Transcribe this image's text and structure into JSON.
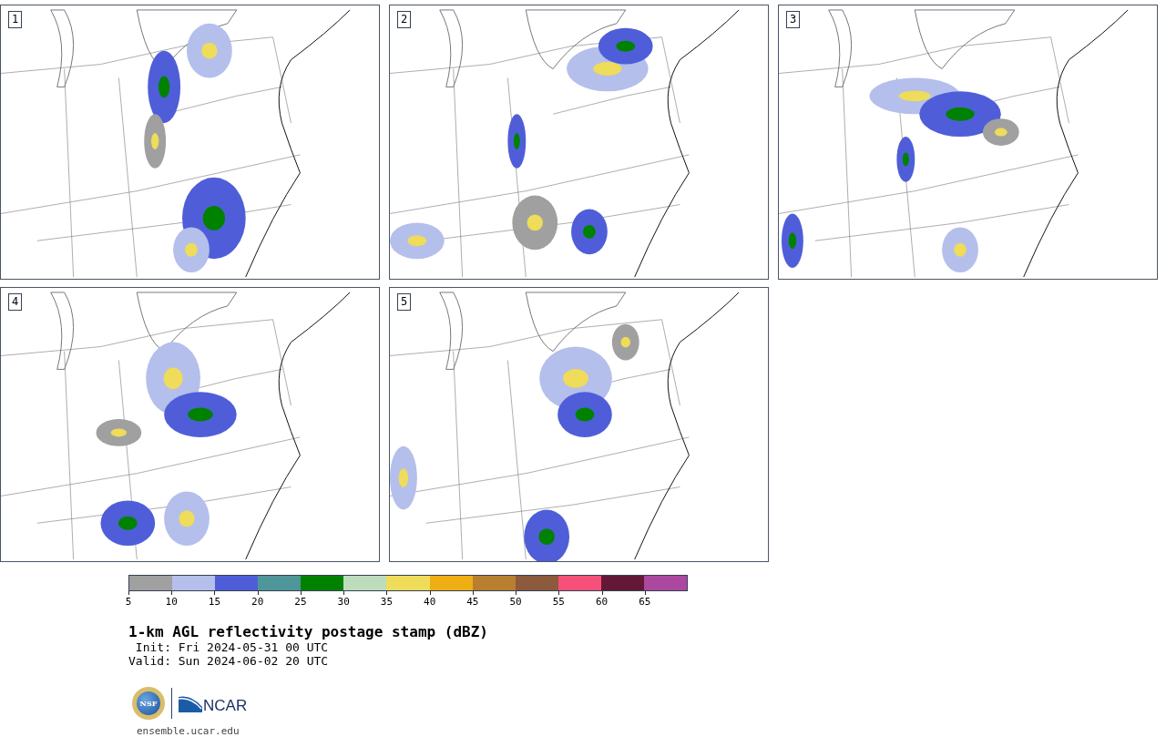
{
  "panels": [
    {
      "label": "1"
    },
    {
      "label": "2"
    },
    {
      "label": "3"
    },
    {
      "label": "4"
    },
    {
      "label": "5"
    }
  ],
  "colorbar": {
    "segments": [
      {
        "color": "#a0a0a0"
      },
      {
        "color": "#b4bfec"
      },
      {
        "color": "#4f5ed8"
      },
      {
        "color": "#4e9699"
      },
      {
        "color": "#008200"
      },
      {
        "color": "#bcdcbc"
      },
      {
        "color": "#eedc5a"
      },
      {
        "color": "#eeae14"
      },
      {
        "color": "#b87f30"
      },
      {
        "color": "#8c5a3c"
      },
      {
        "color": "#f4507a"
      },
      {
        "color": "#621836"
      },
      {
        "color": "#ac48a0"
      }
    ],
    "ticks": [
      "5",
      "10",
      "15",
      "20",
      "25",
      "30",
      "35",
      "40",
      "45",
      "50",
      "55",
      "60",
      "65"
    ]
  },
  "title": "1-km AGL reflectivity postage stamp (dBZ)",
  "init": " Init: Fri 2024-05-31 00 UTC",
  "valid": "Valid: Sun 2024-06-02 20 UTC",
  "logos": {
    "nsf": "NSF",
    "ncar": "NCAR"
  },
  "site": "ensemble.ucar.edu"
}
